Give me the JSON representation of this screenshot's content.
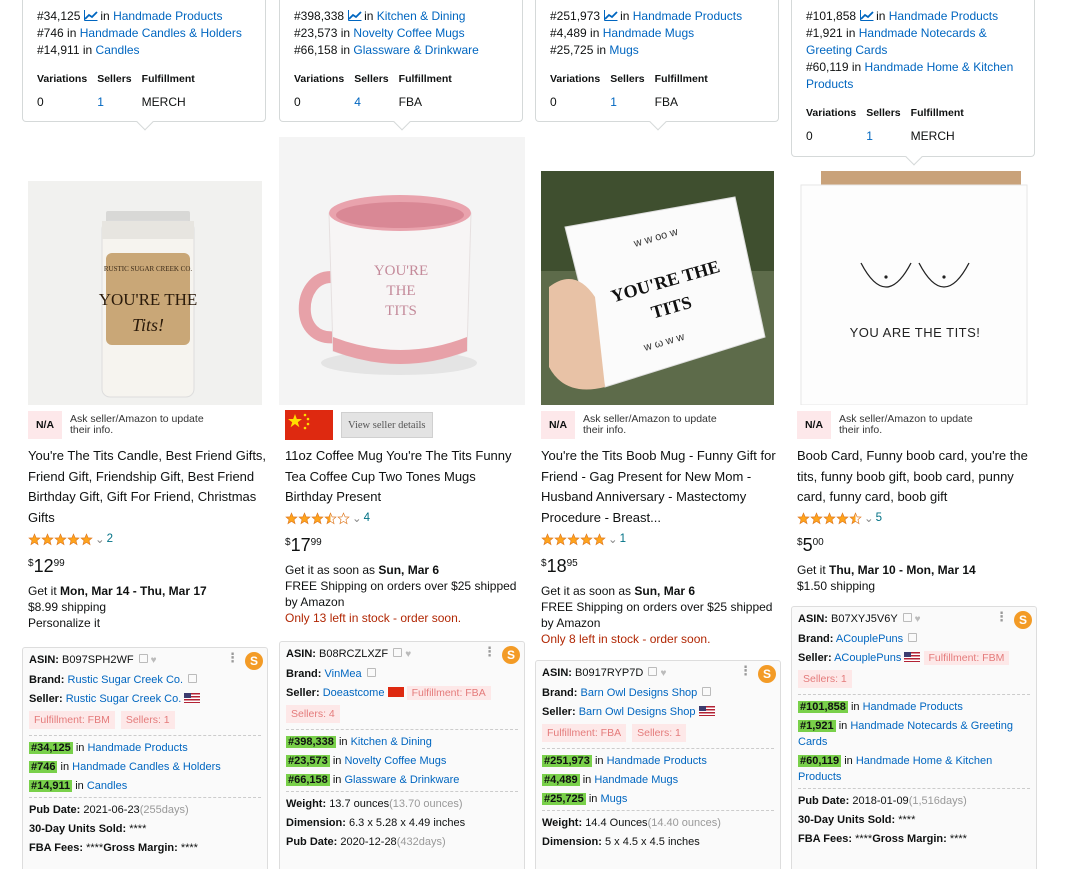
{
  "products": [
    {
      "popup": {
        "ranks": [
          {
            "rank": "#34,125",
            "category": "Handmade Products",
            "chart": true
          },
          {
            "rank": "#746",
            "category": "Handmade Candles & Holders"
          },
          {
            "rank": "#14,911",
            "category": "Candles"
          }
        ],
        "headers": [
          "Variations",
          "Sellers",
          "Fulfillment"
        ],
        "values": {
          "variations": "0",
          "sellers": "1",
          "fulfillment": "MERCH"
        }
      },
      "image_label": "YOU'RE THE Tits! candle",
      "seller_info": {
        "badge": "N/A",
        "text": "Ask seller/Amazon to update their info."
      },
      "title": "You're The Tits Candle, Best Friend Gifts, Friend Gift, Friendship Gift, Best Friend Birthday Gift, Gift For Friend, Christmas Gifts",
      "rating": {
        "stars": 5,
        "count": "2"
      },
      "price": {
        "dollars": "12",
        "cents": "99"
      },
      "delivery": {
        "prefix": "Get it ",
        "date": "Mon, Mar 14 - Thu, Mar 17",
        "line2": "$8.99 shipping",
        "line3": "Personalize it"
      },
      "panel": {
        "asin": "B097SPH2WF",
        "brand": "Rustic Sugar Creek Co.",
        "seller": "Rustic Sugar Creek Co.",
        "tags": [
          "Fulfillment: FBM",
          "Sellers: 1"
        ],
        "ranks": [
          {
            "rank": "#34,125",
            "category": "Handmade Products"
          },
          {
            "rank": "#746",
            "category": "Handmade Candles & Holders"
          },
          {
            "rank": "#14,911",
            "category": "Candles"
          }
        ],
        "pub_date": "2021-06-23",
        "pub_days": "(255days)",
        "units_sold": "****",
        "fba_fees": "****",
        "gross_margin": "****"
      }
    },
    {
      "popup": {
        "ranks": [
          {
            "rank": "#398,338",
            "category": "Kitchen & Dining",
            "chart": true
          },
          {
            "rank": "#23,573",
            "category": "Novelty Coffee Mugs"
          },
          {
            "rank": "#66,158",
            "category": "Glassware & Drinkware"
          }
        ],
        "headers": [
          "Variations",
          "Sellers",
          "Fulfillment"
        ],
        "values": {
          "variations": "0",
          "sellers": "4",
          "fulfillment": "FBA"
        }
      },
      "image_label": "YOU'RE THE TITS mug",
      "seller_info": {
        "button": "View seller details"
      },
      "title": "11oz Coffee Mug You're The Tits Funny Tea Coffee Cup Two Tones Mugs Birthday Present",
      "rating": {
        "stars": 3.5,
        "count": "4"
      },
      "price": {
        "dollars": "17",
        "cents": "99"
      },
      "delivery": {
        "prefix": "Get it as soon as ",
        "date": "Sun, Mar 6",
        "line2": "FREE Shipping on orders over $25 shipped by Amazon",
        "stock": "Only 13 left in stock - order soon."
      },
      "panel": {
        "asin": "B08RCZLXZF",
        "brand": "VinMea",
        "seller": "Doeastcome",
        "tags": [
          "Fulfillment: FBA",
          "Sellers: 4"
        ],
        "ranks": [
          {
            "rank": "#398,338",
            "category": "Kitchen & Dining"
          },
          {
            "rank": "#23,573",
            "category": "Novelty Coffee Mugs"
          },
          {
            "rank": "#66,158",
            "category": "Glassware & Drinkware"
          }
        ],
        "weight": "13.7 ounces",
        "weight_paren": "(13.70 ounces)",
        "dimension": "6.3 x 5.28 x 4.49 inches",
        "pub_date": "2020-12-28",
        "pub_days": "(432days)"
      }
    },
    {
      "popup": {
        "ranks": [
          {
            "rank": "#251,973",
            "category": "Handmade Products",
            "chart": true
          },
          {
            "rank": "#4,489",
            "category": "Handmade Mugs"
          },
          {
            "rank": "#25,725",
            "category": "Mugs"
          }
        ],
        "headers": [
          "Variations",
          "Sellers",
          "Fulfillment"
        ],
        "values": {
          "variations": "0",
          "sellers": "1",
          "fulfillment": "FBA"
        }
      },
      "image_label": "YOU'RE THE TITS mug in hand",
      "seller_info": {
        "badge": "N/A",
        "text": "Ask seller/Amazon to update their info."
      },
      "title": "You're the Tits Boob Mug - Funny Gift for Friend - Gag Present for New Mom - Husband Anniversary - Mastectomy Procedure - Breast...",
      "rating": {
        "stars": 5,
        "count": "1"
      },
      "price": {
        "dollars": "18",
        "cents": "95"
      },
      "delivery": {
        "prefix": "Get it as soon as ",
        "date": "Sun, Mar 6",
        "line2": "FREE Shipping on orders over $25 shipped by Amazon",
        "stock": "Only 8 left in stock - order soon."
      },
      "panel": {
        "asin": "B0917RYP7D",
        "brand": "Barn Owl Designs Shop",
        "seller": "Barn Owl Designs Shop",
        "tags": [
          "Fulfillment: FBA",
          "Sellers: 1"
        ],
        "ranks": [
          {
            "rank": "#251,973",
            "category": "Handmade Products"
          },
          {
            "rank": "#4,489",
            "category": "Handmade Mugs"
          },
          {
            "rank": "#25,725",
            "category": "Mugs"
          }
        ],
        "weight": "14.4 Ounces",
        "weight_paren": "(14.40 ounces)",
        "dimension": "5 x 4.5 x 4.5 inches"
      }
    },
    {
      "popup": {
        "ranks": [
          {
            "rank": "#101,858",
            "category": "Handmade Products",
            "chart": true
          },
          {
            "rank": "#1,921",
            "category": "Handmade Notecards & Greeting Cards"
          },
          {
            "rank": "#60,119",
            "category": "Handmade Home & Kitchen Products"
          }
        ],
        "headers": [
          "Variations",
          "Sellers",
          "Fulfillment"
        ],
        "values": {
          "variations": "0",
          "sellers": "1",
          "fulfillment": "MERCH"
        }
      },
      "image_label": "YOU ARE THE TITS!",
      "seller_info": {
        "badge": "N/A",
        "text": "Ask seller/Amazon to update their info."
      },
      "title": "Boob Card, Funny boob card, you're the tits, funny boob gift, boob card, punny card, funny card, boob gift",
      "rating": {
        "stars": 4.5,
        "count": "5"
      },
      "price": {
        "dollars": "5",
        "cents": "00"
      },
      "delivery": {
        "prefix": "Get it ",
        "date": "Thu, Mar 10 - Mon, Mar 14",
        "line2": "$1.50 shipping"
      },
      "panel": {
        "asin": "B07XYJ5V6Y",
        "brand": "ACouplePuns",
        "seller": "ACouplePuns",
        "tags": [
          "Fulfillment: FBM",
          "Sellers: 1"
        ],
        "ranks": [
          {
            "rank": "#101,858",
            "category": "Handmade Products"
          },
          {
            "rank": "#1,921",
            "category": "Handmade Notecards & Greeting Cards"
          },
          {
            "rank": "#60,119",
            "category": "Handmade Home & Kitchen Products"
          }
        ],
        "pub_date": "2018-01-09",
        "pub_days": "(1,516days)",
        "units_sold": "****",
        "fba_fees": "****",
        "gross_margin": "****"
      }
    }
  ],
  "labels": {
    "in": "in",
    "asin": "ASIN:",
    "brand": "Brand:",
    "seller": "Seller:",
    "pub_date": "Pub Date:",
    "units_sold": "30-Day Units Sold:",
    "fba_fees": "FBA Fees:",
    "gross_margin": "Gross Margin:",
    "weight": "Weight:",
    "dimension": "Dimension:"
  },
  "colors": {
    "link": "#0066c0",
    "star": "#ffa41c",
    "stock": "#b12704",
    "highlight": "#79d04a",
    "tag_bg": "#fde8e8"
  }
}
